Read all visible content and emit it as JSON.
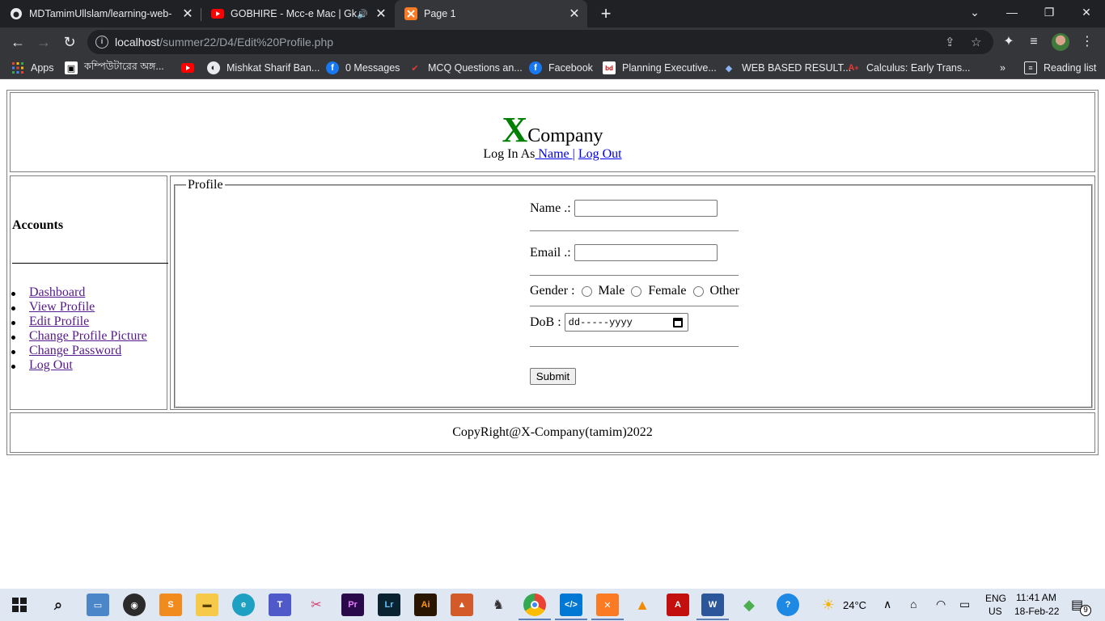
{
  "browser": {
    "tabs": [
      {
        "title": "MDTamimUllslam/learning-web-",
        "icon": "github-icon",
        "active": false
      },
      {
        "title": "GOBHIRE - Mcc-e Mac | Gk K",
        "icon": "youtube-icon",
        "active": false
      },
      {
        "title": "Page 1",
        "icon": "xampp-icon",
        "active": true
      }
    ],
    "url_host": "localhost",
    "url_path": "/summer22/D4/Edit%20Profile.php",
    "bookmarks": [
      {
        "label": "Apps",
        "icon": "apps-grid-icon"
      },
      {
        "label": "কম্পিউটারের অঙ্গ...",
        "icon": "computer-parts-icon"
      },
      {
        "label": "",
        "icon": "youtube-icon"
      },
      {
        "label": "Mishkat Sharif Ban...",
        "icon": "globe-icon"
      },
      {
        "label": "0 Messages",
        "icon": "facebook-icon"
      },
      {
        "label": "MCQ Questions an...",
        "icon": "mcq-icon"
      },
      {
        "label": "Facebook",
        "icon": "facebook-icon"
      },
      {
        "label": "Planning Executive...",
        "icon": "job-site-icon"
      },
      {
        "label": "WEB BASED RESULT...",
        "icon": "result-icon"
      },
      {
        "label": "Calculus: Early Trans...",
        "icon": "calculus-icon"
      }
    ],
    "more_bookmarks": "»",
    "reading_list": "Reading list"
  },
  "site": {
    "logo_x": "X",
    "logo_rest": "Company",
    "login_prefix": "Log In As",
    "name_link": " Name ",
    "separator": "|",
    "logout_link": "Log Out",
    "sidebar_title": "Accounts",
    "menu": [
      "Dashboard",
      "View Profile",
      "Edit Profile",
      "Change Profile Picture",
      "Change Password",
      "Log Out"
    ],
    "legend": "Profile",
    "name_label": "Name .:",
    "email_label": "Email .:",
    "gender_label": "Gender :",
    "gender_options": [
      "Male",
      "Female",
      "Other"
    ],
    "dob_label": "DoB :",
    "dob_placeholder": "dd-----yyyy",
    "submit": "Submit",
    "footer": "CopyRight@X-Company(tamim)2022"
  },
  "taskbar": {
    "weather": "24°C",
    "lang": "ENG",
    "region": "US",
    "time": "11:41 AM",
    "date": "18-Feb-22",
    "notifications": "9"
  },
  "colors": {
    "logo_x": "#008000",
    "link_unvisited": "#0000ee",
    "link_visited": "#551a8b"
  }
}
